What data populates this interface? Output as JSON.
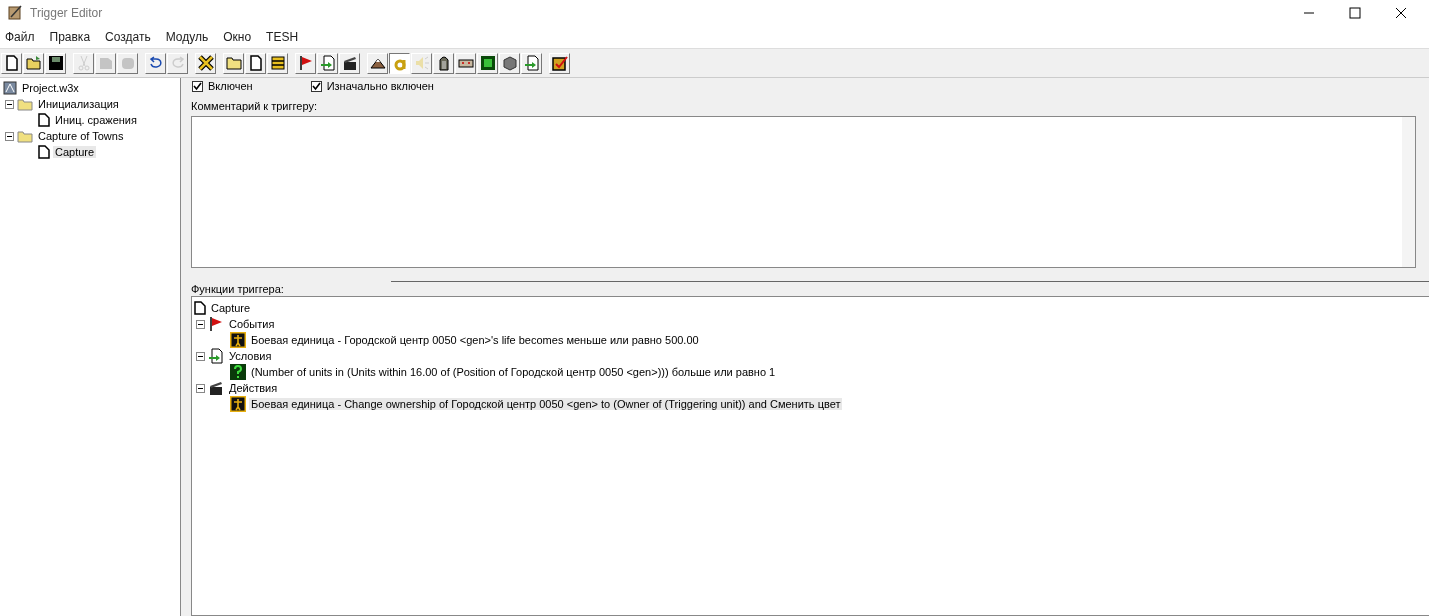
{
  "window": {
    "title": "Trigger Editor"
  },
  "menu": [
    "Файл",
    "Правка",
    "Создать",
    "Модуль",
    "Окно",
    "TESH"
  ],
  "toolbar": [
    [
      {
        "disabled": false,
        "selected": false
      },
      {
        "disabled": false,
        "selected": false
      },
      {
        "disabled": false,
        "selected": false
      }
    ],
    [
      {
        "disabled": true,
        "selected": false
      },
      {
        "disabled": true,
        "selected": false
      },
      {
        "disabled": true,
        "selected": false
      }
    ],
    [
      {
        "disabled": false,
        "selected": false
      },
      {
        "disabled": true,
        "selected": false
      }
    ],
    [
      {
        "disabled": false,
        "selected": false
      }
    ],
    [
      {
        "disabled": false,
        "selected": false
      },
      {
        "disabled": false,
        "selected": false
      },
      {
        "disabled": false,
        "selected": false
      }
    ],
    [
      {
        "disabled": false,
        "selected": false
      },
      {
        "disabled": false,
        "selected": false
      },
      {
        "disabled": false,
        "selected": false
      }
    ],
    [
      {
        "disabled": false,
        "selected": false
      },
      {
        "disabled": false,
        "selected": true
      },
      {
        "disabled": true,
        "selected": false
      },
      {
        "disabled": false,
        "selected": false
      },
      {
        "disabled": false,
        "selected": false
      },
      {
        "disabled": false,
        "selected": false
      },
      {
        "disabled": false,
        "selected": false
      },
      {
        "disabled": false,
        "selected": false
      }
    ],
    [
      {
        "disabled": false,
        "selected": false
      }
    ]
  ],
  "sidebar": {
    "project": "Project.w3x",
    "items": [
      {
        "label": "Инициализация",
        "expanded": true,
        "children": [
          {
            "label": "Иниц. сражения",
            "selected": false
          }
        ]
      },
      {
        "label": "Capture of Towns",
        "expanded": true,
        "children": [
          {
            "label": "Capture",
            "selected": true
          }
        ]
      }
    ]
  },
  "options": [
    {
      "label": "Включен",
      "checked": true
    },
    {
      "label": "Изначально включен",
      "checked": true
    }
  ],
  "comment": {
    "label": "Комментарий к триггеру:"
  },
  "functions": {
    "label": "Функции триггера:",
    "root": "Capture",
    "groups": [
      {
        "kind": "event",
        "label": "События",
        "expanded": true,
        "children": [
          {
            "kind": "unit",
            "label": "Боевая единица - Городской центр 0050 <gen>'s life becomes меньше или равно 500.00",
            "selected": false
          }
        ]
      },
      {
        "kind": "condition",
        "label": "Условия",
        "expanded": true,
        "children": [
          {
            "kind": "condition",
            "label": "(Number of units in (Units within 16.00 of (Position of Городской центр 0050 <gen>))) больше или равно 1",
            "selected": false
          }
        ]
      },
      {
        "kind": "action",
        "label": "Действия",
        "expanded": true,
        "children": [
          {
            "kind": "unit",
            "label": "Боевая единица - Change ownership of Городской центр 0050 <gen> to (Owner of (Triggering unit)) and Сменить цвет",
            "selected": true
          }
        ]
      }
    ]
  }
}
